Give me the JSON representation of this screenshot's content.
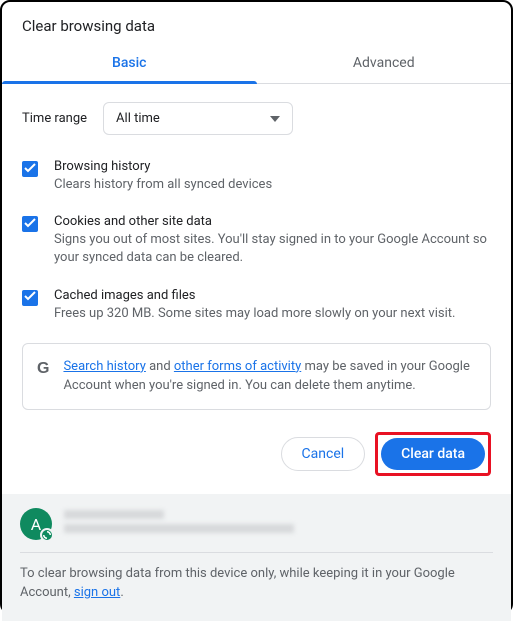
{
  "dialog": {
    "title": "Clear browsing data"
  },
  "tabs": {
    "basic": "Basic",
    "advanced": "Advanced",
    "active": "basic"
  },
  "timeRange": {
    "label": "Time range",
    "value": "All time"
  },
  "options": {
    "history": {
      "title": "Browsing history",
      "desc": "Clears history from all synced devices"
    },
    "cookies": {
      "title": "Cookies and other site data",
      "desc": "Signs you out of most sites. You'll stay signed in to your Google Account so your synced data can be cleared."
    },
    "cache": {
      "title": "Cached images and files",
      "desc": "Frees up 320 MB. Some sites may load more slowly on your next visit."
    }
  },
  "info": {
    "link1": "Search history",
    "mid1": " and ",
    "link2": "other forms of activity",
    "rest": " may be saved in your Google Account when you're signed in. You can delete them anytime."
  },
  "buttons": {
    "cancel": "Cancel",
    "clear": "Clear data"
  },
  "account": {
    "initial": "A"
  },
  "footer": {
    "text1": "To clear browsing data from this device only, while keeping it in your Google Account, ",
    "signout": "sign out",
    "text2": "."
  }
}
